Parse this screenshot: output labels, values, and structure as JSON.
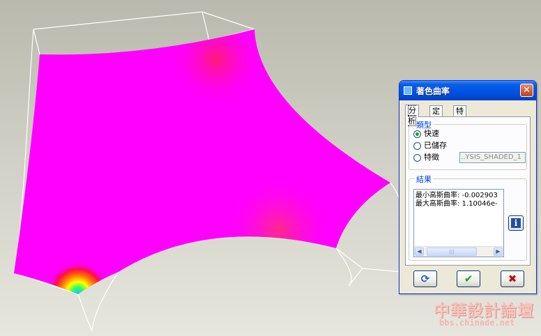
{
  "dialog": {
    "title": "著色曲率",
    "close_glyph": "✕",
    "tabs": [
      "分析",
      "定義",
      "特徵"
    ],
    "type_group": {
      "label": "類型",
      "options": [
        {
          "label": "快速",
          "checked": true
        },
        {
          "label": "已儲存",
          "checked": false
        },
        {
          "label": "特徵",
          "checked": false
        }
      ],
      "saved_field_value": "..YSIS_SHADED_1"
    },
    "results_group": {
      "label": "結果",
      "min_line": "最小高斯曲率: -0.002903",
      "max_line": "最大高斯曲率: 1.10046e-"
    },
    "icons": {
      "info": "i",
      "repaint": "⟳",
      "ok": "✔",
      "cancel": "✖"
    },
    "colors": {
      "title_bar": "#0054e3",
      "ok_icon": "#1b9e1b",
      "cancel_icon": "#b01414",
      "repaint_icon": "#2b5fd0"
    }
  },
  "watermark": {
    "logo": "中華設計論壇",
    "url": "bbs.chinade.net"
  }
}
